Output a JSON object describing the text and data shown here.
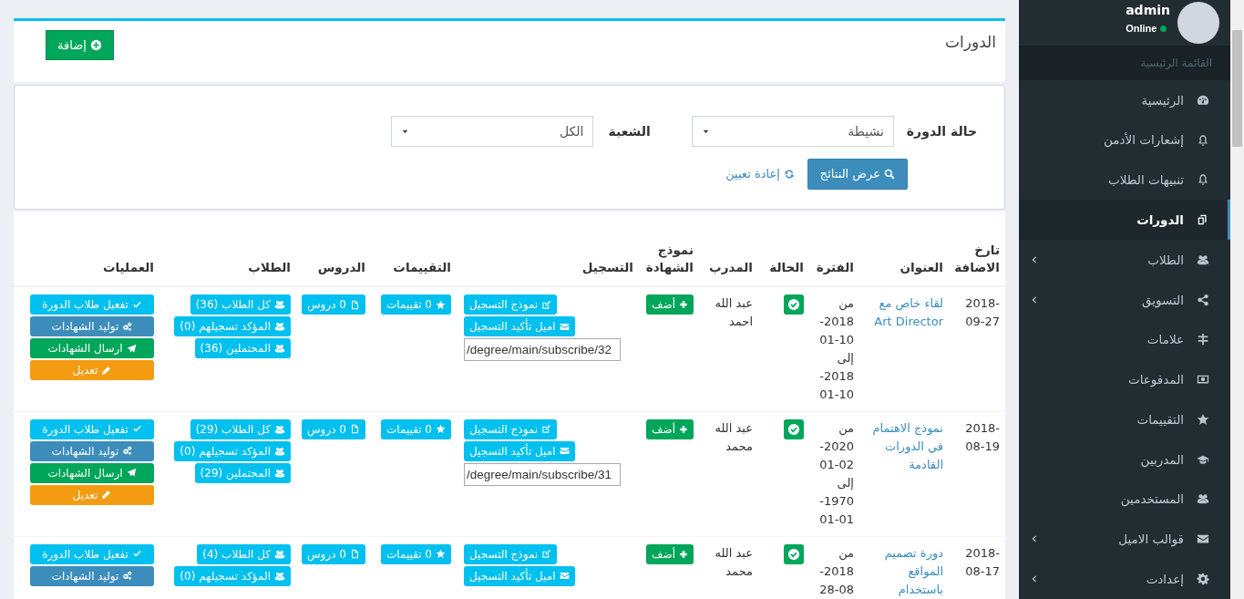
{
  "page": {
    "title": "الدورات",
    "add_button": "إضافة"
  },
  "filters": {
    "fields": [
      {
        "label": "حالة الدورة",
        "value": "نشيطة"
      },
      {
        "label": "الشعبة",
        "value": "الكل"
      }
    ],
    "search_button": "عرض النتائج",
    "reset_link": "إعادة تعيين"
  },
  "table": {
    "columns": [
      "تارخ الاضافة",
      "العنوان",
      "الفترة",
      "الحالة",
      "المدرب",
      "نموذج الشهادة",
      "التسجيل",
      "التقييمات",
      "الدروس",
      "الطلاب",
      "العمليات"
    ],
    "rows": [
      {
        "date": "2018-09-27",
        "title": "لقاء خاص مع Art Director",
        "period": "من 2018-10-01 إلى 2018-10-01",
        "active": true,
        "trainer": "عبد الله احمد",
        "certificate_button": "أضف",
        "registration_buttons": [
          "نموذج التسجيل",
          "اميل تأكيد التسجيل"
        ],
        "registration_link": "/degree/main/subscribe/32",
        "ratings": "0 تقييمات",
        "lessons": "0 دروس",
        "students": [
          "كل الطلاب (36)",
          "المؤكد تسجيلهم (0)",
          "المحتملين (36)"
        ],
        "operations": [
          {
            "kind": "activate",
            "label": "تفعيل طلاب الدورة"
          },
          {
            "kind": "generate",
            "label": "توليد الشهادات"
          },
          {
            "kind": "send",
            "label": "ارسال الشهادات"
          },
          {
            "kind": "edit",
            "label": "تعديل"
          }
        ]
      },
      {
        "date": "2018-08-19",
        "title": "نموذج الاهتمام في الدورات القادمة",
        "period": "من 2020-02-01 إلى 1970-01-01",
        "active": true,
        "trainer": "عبد الله محمد",
        "certificate_button": "أضف",
        "registration_buttons": [
          "نموذج التسجيل",
          "اميل تأكيد التسجيل"
        ],
        "registration_link": "/degree/main/subscribe/31",
        "ratings": "0 تقييمات",
        "lessons": "0 دروس",
        "students": [
          "كل الطلاب (29)",
          "المؤكد تسجيلهم (0)",
          "المحتملين (29)"
        ],
        "operations": [
          {
            "kind": "activate",
            "label": "تفعيل طلاب الدورة"
          },
          {
            "kind": "generate",
            "label": "توليد الشهادات"
          },
          {
            "kind": "send",
            "label": "ارسال الشهادات"
          },
          {
            "kind": "edit",
            "label": "تعديل"
          }
        ]
      },
      {
        "date": "2018-08-17",
        "title": "دورة تصميم المواقع باستخدام",
        "period": "من 2018-08-28",
        "active": true,
        "trainer": "عبد الله محمد",
        "certificate_button": "أضف",
        "registration_buttons": [
          "نموذج التسجيل",
          "اميل تأكيد التسجيل"
        ],
        "ratings": "0 تقييمات",
        "lessons": "0 دروس",
        "students": [
          "كل الطلاب (4)",
          "المؤكد تسجيلهم (0)"
        ],
        "operations": [
          {
            "kind": "activate",
            "label": "تفعيل طلاب الدورة"
          },
          {
            "kind": "generate",
            "label": "توليد الشهادات"
          }
        ]
      }
    ]
  },
  "sidebar": {
    "user": {
      "name": "admin",
      "status": "Online"
    },
    "menu_header": "القائمة الرئيسية",
    "items": [
      {
        "label": "الرئيسية",
        "selected": false,
        "expandable": false
      },
      {
        "label": "إشعارات الأدمن",
        "selected": false,
        "expandable": false
      },
      {
        "label": "تنبيهات الطلاب",
        "selected": false,
        "expandable": false
      },
      {
        "label": "الدورات",
        "selected": true,
        "expandable": false
      },
      {
        "label": "الطلاب",
        "selected": false,
        "expandable": true
      },
      {
        "label": "التسويق",
        "selected": false,
        "expandable": true
      },
      {
        "label": "علامات",
        "selected": false,
        "expandable": false
      },
      {
        "label": "المدفوعات",
        "selected": false,
        "expandable": false
      },
      {
        "label": "التقييمات",
        "selected": false,
        "expandable": false
      },
      {
        "label": "المدربين",
        "selected": false,
        "expandable": false
      },
      {
        "label": "المستخدمين",
        "selected": false,
        "expandable": false
      },
      {
        "label": "قوالب الاميل",
        "selected": false,
        "expandable": true
      },
      {
        "label": "إعدادت",
        "selected": false,
        "expandable": true
      }
    ]
  }
}
